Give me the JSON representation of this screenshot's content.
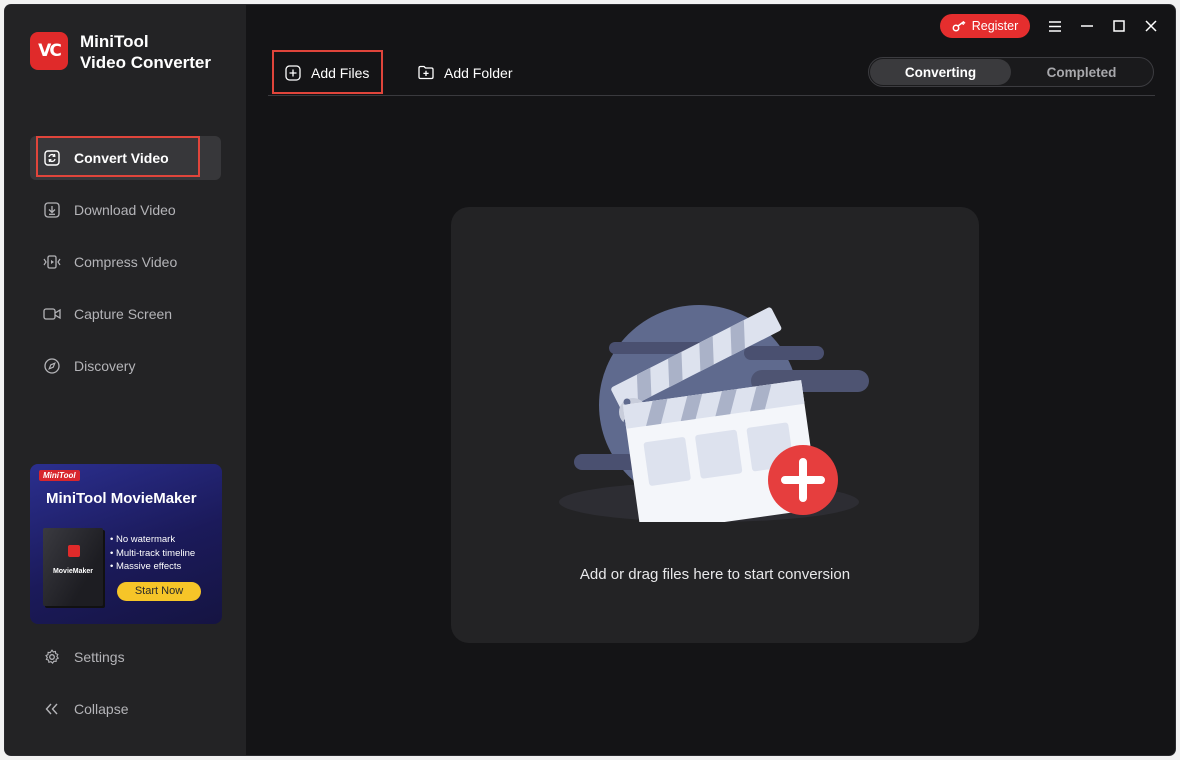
{
  "app": {
    "logo_text": "VC",
    "name_line1": "MiniTool",
    "name_line2": "Video Converter"
  },
  "sidebar": {
    "items": [
      {
        "label": "Convert Video",
        "icon": "convert-icon",
        "active": true
      },
      {
        "label": "Download Video",
        "icon": "download-icon",
        "active": false
      },
      {
        "label": "Compress Video",
        "icon": "compress-icon",
        "active": false
      },
      {
        "label": "Capture Screen",
        "icon": "camera-icon",
        "active": false
      },
      {
        "label": "Discovery",
        "icon": "compass-icon",
        "active": false
      }
    ],
    "settings_label": "Settings",
    "collapse_label": "Collapse"
  },
  "promo": {
    "brand": "MiniTool",
    "title": "MiniTool MovieMaker",
    "box_name": "MovieMaker",
    "features": [
      "No watermark",
      "Multi-track timeline",
      "Massive effects"
    ],
    "button_label": "Start Now"
  },
  "titlebar": {
    "register_label": "Register"
  },
  "toolbar": {
    "add_files_label": "Add Files",
    "add_folder_label": "Add Folder"
  },
  "tabs": {
    "converting": "Converting",
    "completed": "Completed"
  },
  "dropzone": {
    "text": "Add or drag files here to start conversion"
  },
  "colors": {
    "accent_red": "#e52e2e",
    "highlight_outline": "#e0453b",
    "promo_button": "#f6c528",
    "sidebar_bg": "#232325",
    "main_bg": "#141416"
  }
}
